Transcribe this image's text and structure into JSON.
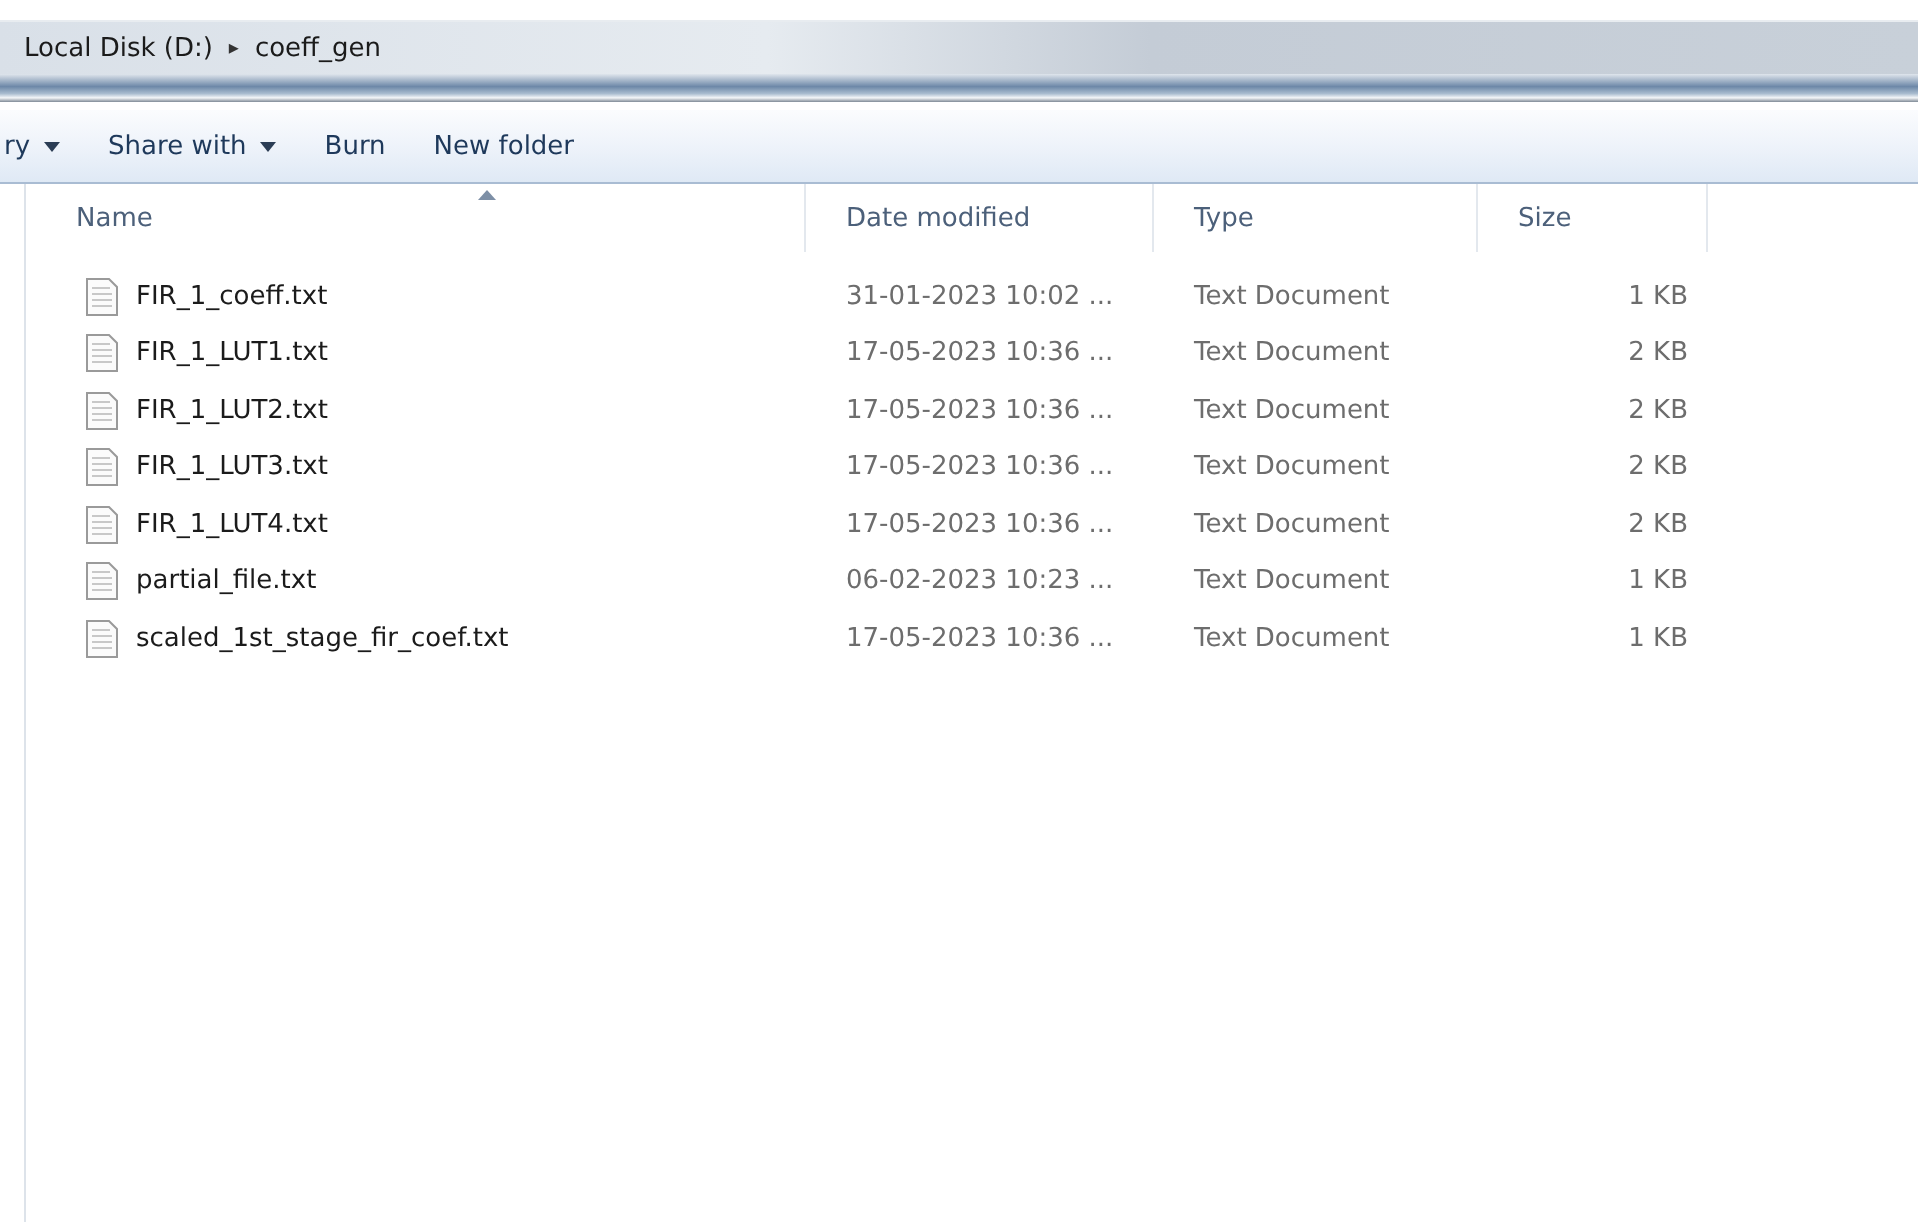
{
  "breadcrumb": {
    "parent": "Local Disk (D:)",
    "separator": "▸",
    "current": "coeff_gen"
  },
  "toolbar": [
    {
      "label": "ry",
      "dropdown": true
    },
    {
      "label": "Share with",
      "dropdown": true
    },
    {
      "label": "Burn",
      "dropdown": false
    },
    {
      "label": "New folder",
      "dropdown": false
    }
  ],
  "columns": [
    {
      "label": "Name",
      "sorted": true
    },
    {
      "label": "Date modified",
      "sorted": false
    },
    {
      "label": "Type",
      "sorted": false
    },
    {
      "label": "Size",
      "sorted": false
    }
  ],
  "files": [
    {
      "name": "FIR_1_coeff.txt",
      "date": "31-01-2023 10:02 ...",
      "type": "Text Document",
      "size": "1 KB"
    },
    {
      "name": "FIR_1_LUT1.txt",
      "date": "17-05-2023 10:36 ...",
      "type": "Text Document",
      "size": "2 KB"
    },
    {
      "name": "FIR_1_LUT2.txt",
      "date": "17-05-2023 10:36 ...",
      "type": "Text Document",
      "size": "2 KB"
    },
    {
      "name": "FIR_1_LUT3.txt",
      "date": "17-05-2023 10:36 ...",
      "type": "Text Document",
      "size": "2 KB"
    },
    {
      "name": "FIR_1_LUT4.txt",
      "date": "17-05-2023 10:36 ...",
      "type": "Text Document",
      "size": "2 KB"
    },
    {
      "name": "partial_file.txt",
      "date": "06-02-2023 10:23 ...",
      "type": "Text Document",
      "size": "1 KB"
    },
    {
      "name": "scaled_1st_stage_fir_coef.txt",
      "date": "17-05-2023 10:36 ...",
      "type": "Text Document",
      "size": "1 KB"
    }
  ]
}
